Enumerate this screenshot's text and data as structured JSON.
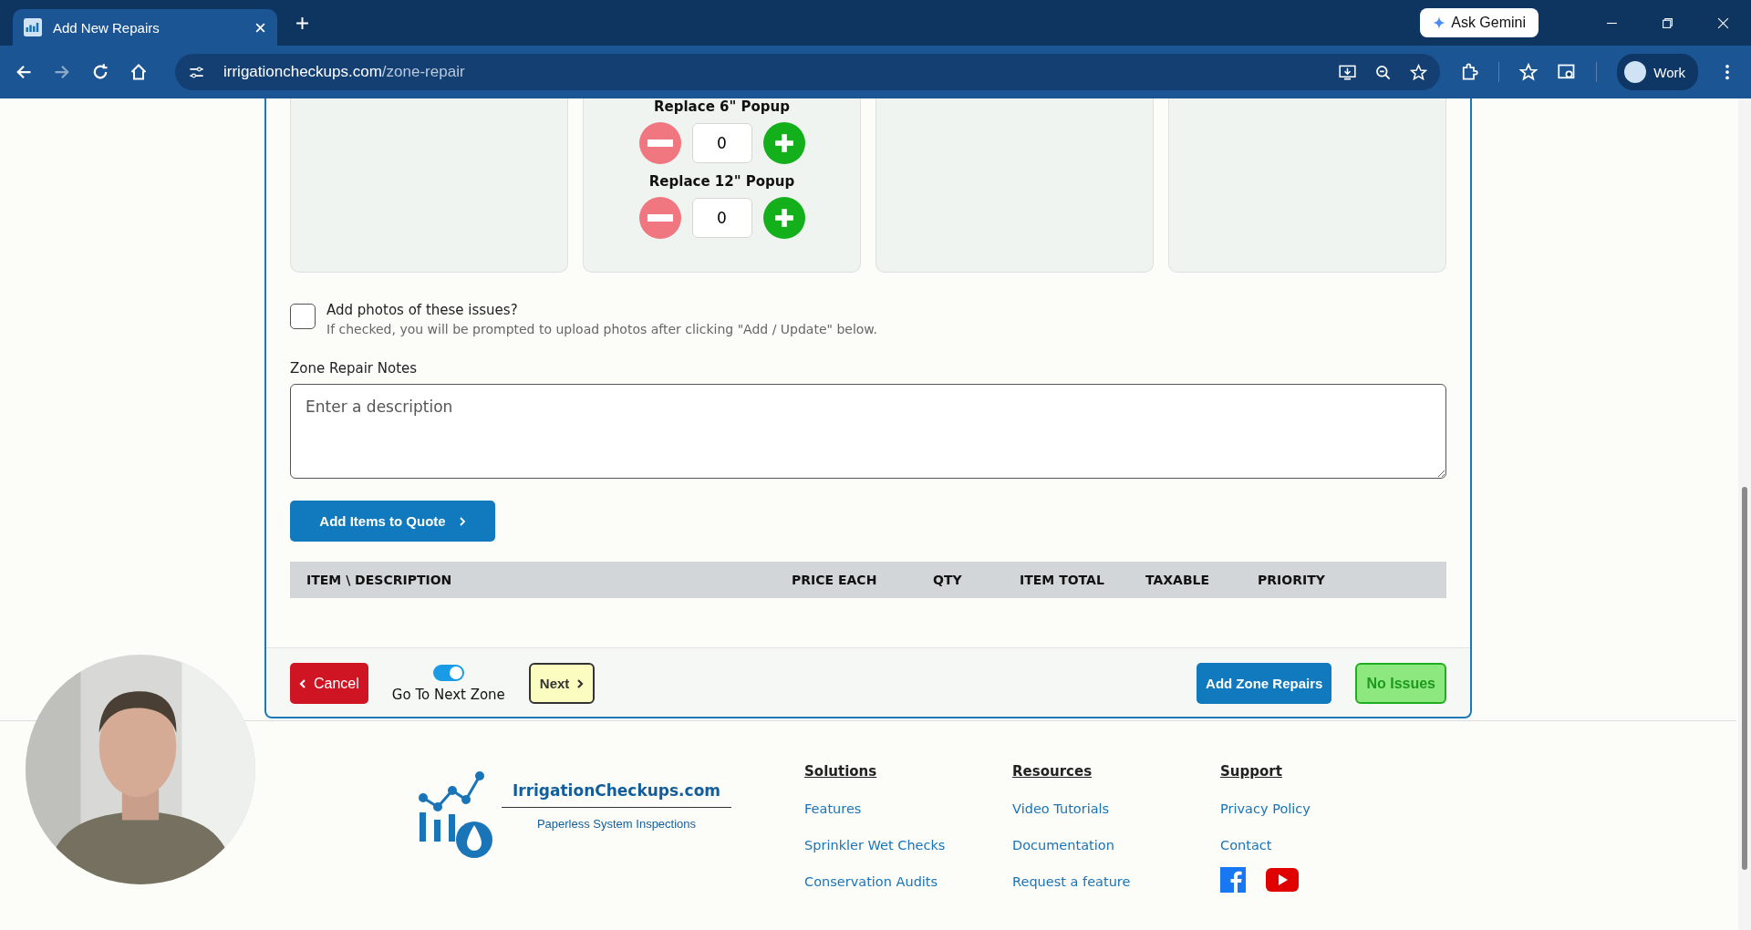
{
  "browser": {
    "tab_title": "Add New Repairs",
    "url_host": "irrigationcheckups.com",
    "url_path": "/zone-repair",
    "ask_button": "Ask Gemini",
    "profile": "Work"
  },
  "repair_cards": [
    {
      "kind": "blank"
    },
    {
      "kind": "counters",
      "counters": [
        {
          "label": "Replace 6\" Popup",
          "value": "0"
        },
        {
          "label": "Replace 12\" Popup",
          "value": "0"
        }
      ]
    },
    {
      "kind": "blank"
    },
    {
      "kind": "blank"
    }
  ],
  "photos": {
    "label": "Add photos of these issues?",
    "hint": "If checked, you will be prompted to upload photos after clicking \"Add / Update\" below.",
    "checked": false
  },
  "notes": {
    "label": "Zone Repair Notes",
    "placeholder": "Enter a description"
  },
  "add_items_button": "Add Items to Quote",
  "table": {
    "columns": [
      "ITEM \\ DESCRIPTION",
      "PRICE EACH",
      "QTY",
      "ITEM TOTAL",
      "TAXABLE",
      "PRIORITY"
    ]
  },
  "actions": {
    "cancel": "Cancel",
    "toggle_label": "Go To Next Zone",
    "toggle_on": true,
    "next": "Next",
    "add_zone": "Add Zone Repairs",
    "no_issues": "No Issues"
  },
  "footer": {
    "brand": "IrrigationCheckups.com",
    "tagline": "Paperless System Inspections",
    "columns": [
      {
        "title": "Solutions",
        "links": [
          "Features",
          "Sprinkler Wet Checks",
          "Conservation Audits"
        ]
      },
      {
        "title": "Resources",
        "links": [
          "Video Tutorials",
          "Documentation",
          "Request a feature"
        ]
      },
      {
        "title": "Support",
        "links": [
          "Privacy Policy",
          "Contact"
        ]
      }
    ]
  }
}
